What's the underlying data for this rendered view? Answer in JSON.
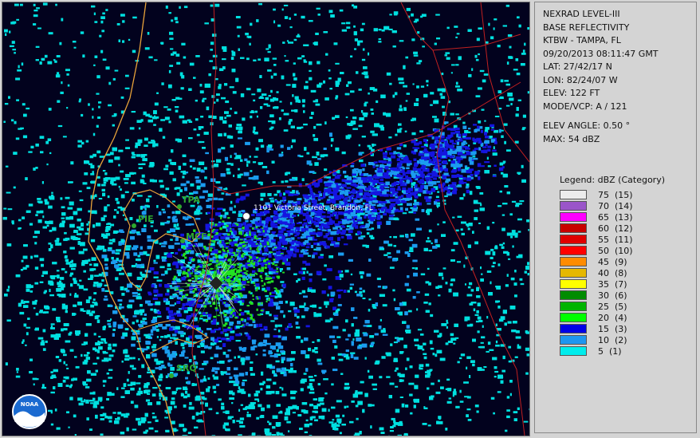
{
  "map": {
    "location_label": "1101 Victoria Street, Brandon, FL",
    "logo_text": "NOAA",
    "airports": [
      {
        "code": "TPA"
      },
      {
        "code": "PIE"
      },
      {
        "code": "MCF"
      },
      {
        "code": "SRQ"
      }
    ],
    "colors": {
      "background": "#02021e",
      "land_boundary": "#e8a23a",
      "county_lines": "#c22020",
      "echo_5": "#00e0e0",
      "echo_10": "#1b9cf0",
      "echo_15": "#1515e0",
      "echo_20": "#22e022"
    }
  },
  "info": {
    "product": "NEXRAD LEVEL-III",
    "type": "BASE REFLECTIVITY",
    "station": "KTBW - TAMPA, FL",
    "datetime": "09/20/2013 08:11:47 GMT",
    "lat": "LAT: 27/42/17 N",
    "lon": "LON: 82/24/07 W",
    "elev": "ELEV: 122 FT",
    "mode": "MODE/VCP: A / 121",
    "elev_angle": "ELEV ANGLE: 0.50 °",
    "max": "MAX: 54 dBZ"
  },
  "legend": {
    "title": "Legend: dBZ (Category)",
    "items": [
      {
        "label": "75  (15)",
        "color": "#ececec"
      },
      {
        "label": "70  (14)",
        "color": "#9a55c9"
      },
      {
        "label": "65  (13)",
        "color": "#ff00ff"
      },
      {
        "label": "60  (12)",
        "color": "#c80000"
      },
      {
        "label": "55  (11)",
        "color": "#e00000"
      },
      {
        "label": "50  (10)",
        "color": "#ff0000"
      },
      {
        "label": "45  (9)",
        "color": "#ff8c00"
      },
      {
        "label": "40  (8)",
        "color": "#e6b800"
      },
      {
        "label": "35  (7)",
        "color": "#ffff00"
      },
      {
        "label": "30  (6)",
        "color": "#008c00"
      },
      {
        "label": "25  (5)",
        "color": "#00b400"
      },
      {
        "label": "20  (4)",
        "color": "#00ff00"
      },
      {
        "label": "15  (3)",
        "color": "#0000e6"
      },
      {
        "label": "10  (2)",
        "color": "#1e96f0"
      },
      {
        "label": "5  (1)",
        "color": "#00ecec"
      }
    ]
  }
}
